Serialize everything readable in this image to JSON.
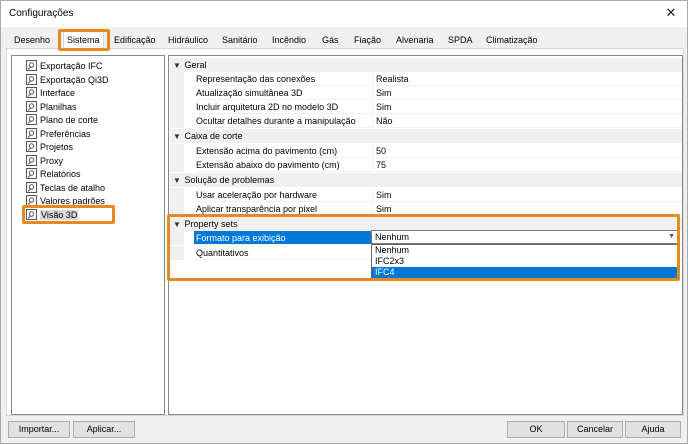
{
  "window": {
    "title": "Configurações",
    "close_glyph": "✕"
  },
  "tabs": [
    {
      "label": "Desenho"
    },
    {
      "label": "Sistema",
      "active": true
    },
    {
      "label": "Edificação"
    },
    {
      "label": "Hidráulico"
    },
    {
      "label": "Sanitário"
    },
    {
      "label": "Incêndio"
    },
    {
      "label": "Gás"
    },
    {
      "label": "Fiação"
    },
    {
      "label": "Alvenaria"
    },
    {
      "label": "SPDA"
    },
    {
      "label": "Climatização"
    }
  ],
  "tree": {
    "icon": "settings-node-icon",
    "items": [
      {
        "label": "Exportação IFC"
      },
      {
        "label": "Exportação Qi3D"
      },
      {
        "label": "Interface"
      },
      {
        "label": "Planilhas"
      },
      {
        "label": "Plano de corte"
      },
      {
        "label": "Preferências"
      },
      {
        "label": "Projetos"
      },
      {
        "label": "Proxy"
      },
      {
        "label": "Relatórios"
      },
      {
        "label": "Teclas de atalho"
      },
      {
        "label": "Valores padrões"
      },
      {
        "label": "Visão 3D",
        "selected": true
      }
    ]
  },
  "properties": {
    "categories": [
      {
        "label": "Geral",
        "rows": [
          {
            "name": "Representação das conexões",
            "value": "Realista"
          },
          {
            "name": "Atualização simultânea 3D",
            "value": "Sim"
          },
          {
            "name": "Incluir arquitetura 2D no modelo 3D",
            "value": "Sim"
          },
          {
            "name": "Ocultar detalhes durante a manipulação",
            "value": "Não"
          }
        ]
      },
      {
        "label": "Caixa de corte",
        "rows": [
          {
            "name": "Extensão acima do pavimento (cm)",
            "value": "50"
          },
          {
            "name": "Extensão abaixo do pavimento (cm)",
            "value": "75"
          }
        ]
      },
      {
        "label": "Solução de problemas",
        "rows": [
          {
            "name": "Usar aceleração por hardware",
            "value": "Sim"
          },
          {
            "name": "Aplicar transparência por pixel",
            "value": "Sim"
          }
        ]
      },
      {
        "label": "Property sets",
        "rows": [
          {
            "name": "Formato para exibição",
            "value": "Nenhum",
            "selected": true
          },
          {
            "name": "Quantitativos",
            "value": ""
          }
        ]
      }
    ]
  },
  "dropdown": {
    "value": "Nenhum",
    "options": [
      {
        "label": "Nenhum"
      },
      {
        "label": "IFC2x3"
      },
      {
        "label": "IFC4",
        "selected": true
      }
    ]
  },
  "buttons": {
    "import": "Importar...",
    "apply": "Aplicar...",
    "ok": "OK",
    "cancel": "Cancelar",
    "help": "Ajuda"
  },
  "colors": {
    "highlight": "#e58a1c",
    "selection": "#0078d7"
  }
}
